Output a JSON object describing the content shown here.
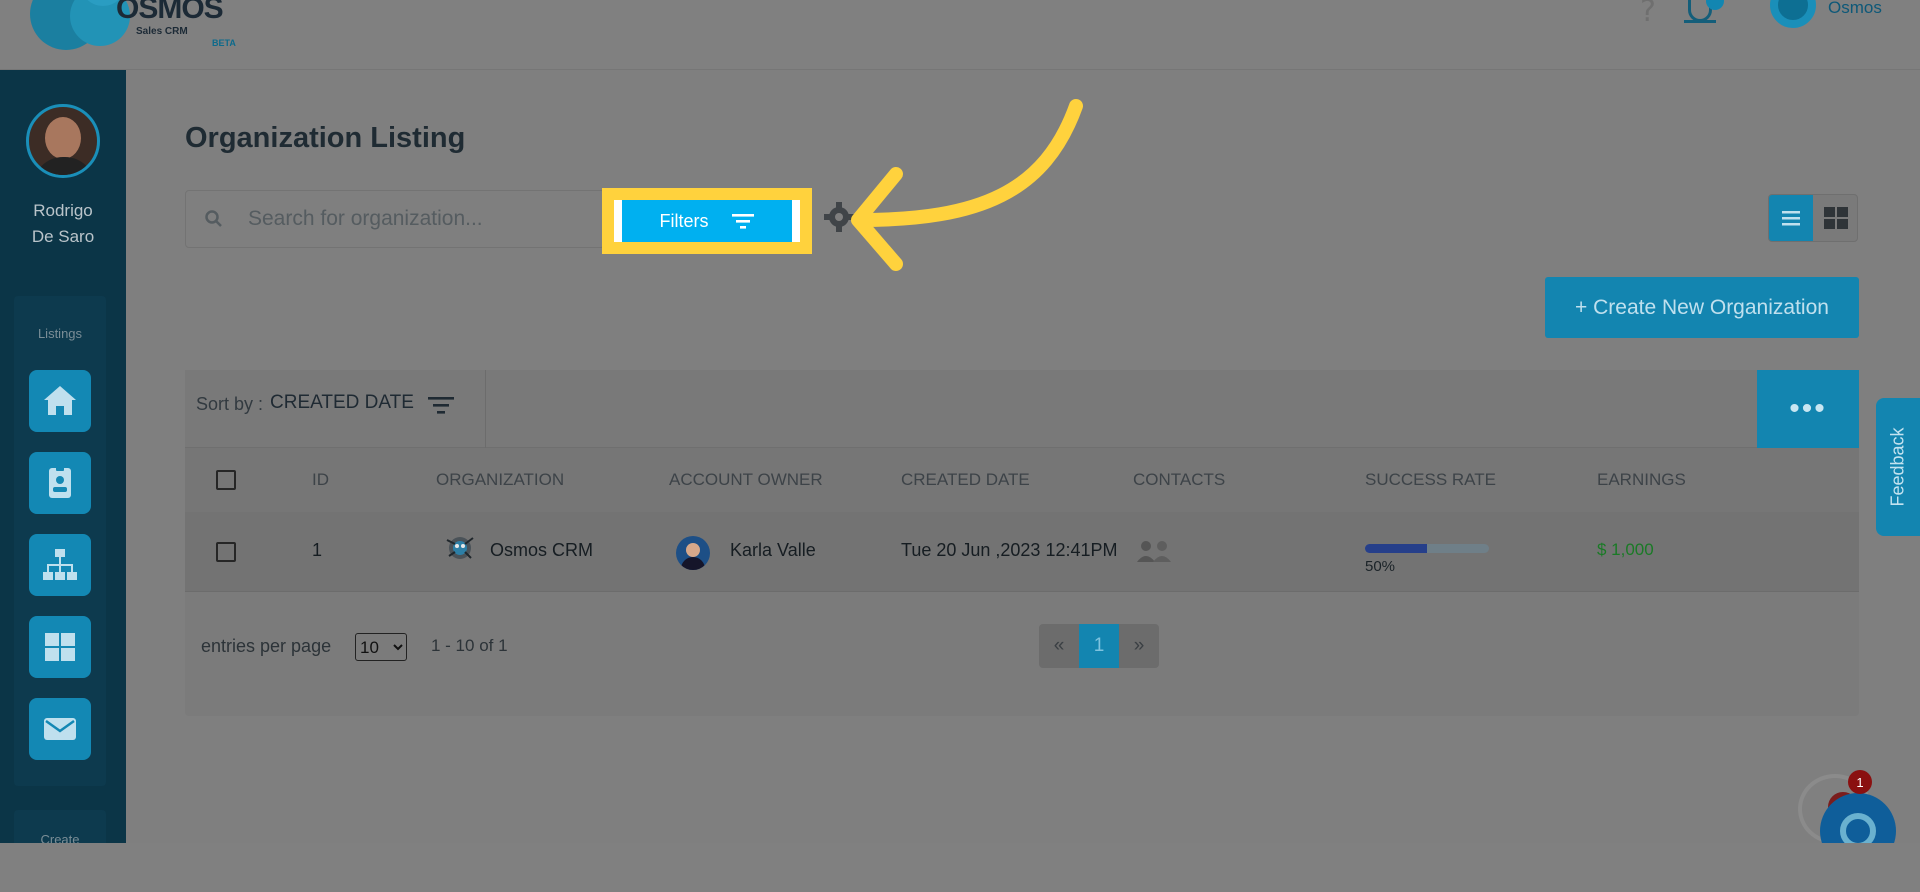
{
  "header": {
    "logo_word": "OSMOS",
    "logo_sub": "Sales CRM",
    "logo_beta": "BETA",
    "help_glyph": "?",
    "user_name": "Osmos"
  },
  "sidebar": {
    "user_first": "Rodrigo",
    "user_last": "De Saro",
    "section_label": "Listings",
    "section2_label": "Create",
    "items": [
      {
        "icon": "home-icon"
      },
      {
        "icon": "contact-card-icon"
      },
      {
        "icon": "org-chart-icon"
      },
      {
        "icon": "grid-icon"
      },
      {
        "icon": "mail-icon"
      }
    ]
  },
  "main": {
    "title": "Organization Listing",
    "search_placeholder": "Search for organization...",
    "filters_label": "Filters",
    "create_label": "+ Create New Organization",
    "sort_label": "Sort by :",
    "sort_value": "CREATED DATE",
    "more_label": "•••"
  },
  "table": {
    "columns": [
      "ID",
      "ORGANIZATION",
      "ACCOUNT OWNER",
      "CREATED DATE",
      "CONTACTS",
      "SUCCESS RATE",
      "EARNINGS"
    ],
    "rows": [
      {
        "id": "1",
        "organization": "Osmos CRM",
        "account_owner": "Karla Valle",
        "created_date": "Tue 20 Jun ,2023 12:41PM",
        "success_rate": 50,
        "success_rate_label": "50%",
        "earnings": "$ 1,000"
      }
    ]
  },
  "pagination": {
    "entries_label": "entries per page",
    "per_page": "10",
    "range": "1 - 10 of 1",
    "prev": "«",
    "current": "1",
    "next": "»"
  },
  "feedback_label": "Feedback",
  "chat_badge": "1",
  "colors": {
    "accent": "#1385b0",
    "highlight": "#ffd23d",
    "filters_button": "#00b0f0",
    "earnings": "#1a7a26"
  }
}
